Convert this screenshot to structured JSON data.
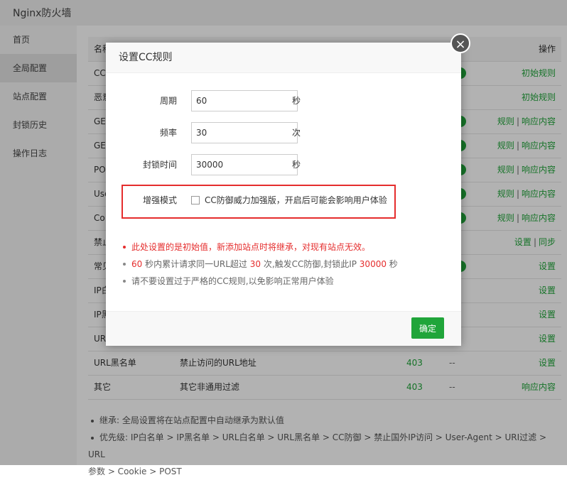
{
  "app": {
    "title": "Nginx防火墙"
  },
  "sidebar": {
    "items": [
      {
        "label": "首页"
      },
      {
        "label": "全局配置"
      },
      {
        "label": "站点配置"
      },
      {
        "label": "封锁历史"
      },
      {
        "label": "操作日志"
      }
    ],
    "active_index": 1
  },
  "table": {
    "header": {
      "name": "名称",
      "ops": "操作"
    },
    "rows": [
      {
        "name": "CC",
        "desc": "",
        "code": "",
        "dash": "",
        "ops": [
          "初始规则"
        ],
        "toggle": true
      },
      {
        "name": "恶意",
        "desc": "",
        "code": "",
        "dash": "",
        "ops": [
          "初始规则"
        ],
        "toggle": false
      },
      {
        "name": "GE",
        "desc": "",
        "code": "",
        "dash": "",
        "ops": [
          "规则",
          "响应内容"
        ],
        "toggle": true
      },
      {
        "name": "GE",
        "desc": "",
        "code": "",
        "dash": "",
        "ops": [
          "规则",
          "响应内容"
        ],
        "toggle": true
      },
      {
        "name": "PO",
        "desc": "",
        "code": "",
        "dash": "",
        "ops": [
          "规则",
          "响应内容"
        ],
        "toggle": true
      },
      {
        "name": "Use",
        "desc": "",
        "code": "",
        "dash": "",
        "ops": [
          "规则",
          "响应内容"
        ],
        "toggle": true
      },
      {
        "name": "Co",
        "desc": "",
        "code": "",
        "dash": "",
        "ops": [
          "规则",
          "响应内容"
        ],
        "toggle": true
      },
      {
        "name": "禁止",
        "desc": "",
        "code": "",
        "dash": "",
        "ops": [
          "设置",
          "同步"
        ],
        "toggle": false
      },
      {
        "name": "常见",
        "desc": "",
        "code": "",
        "dash": "",
        "ops": [
          "设置"
        ],
        "toggle": true
      },
      {
        "name": "IP白",
        "desc": "",
        "code": "",
        "dash": "",
        "ops": [
          "设置"
        ],
        "toggle": false
      },
      {
        "name": "IP黑",
        "desc": "",
        "code": "",
        "dash": "",
        "ops": [
          "设置"
        ],
        "toggle": false
      },
      {
        "name": "URL",
        "desc": "",
        "code": "",
        "dash": "",
        "ops": [
          "设置"
        ],
        "toggle": false
      },
      {
        "name": "URL黑名单",
        "desc": "禁止访问的URL地址",
        "code": "403",
        "dash": "--",
        "ops": [
          "设置"
        ],
        "toggle": false
      },
      {
        "name": "其它",
        "desc": "其它非通用过滤",
        "code": "403",
        "dash": "--",
        "ops": [
          "响应内容"
        ],
        "toggle": false
      }
    ]
  },
  "notes": [
    "继承: 全局设置将在站点配置中自动继承为默认值",
    "优先级: IP白名单 > IP黑名单 > URL白名单 > URL黑名单 > CC防御 > 禁止国外IP访问 > User-Agent > URI过滤 > URL",
    "参数 > Cookie > POST"
  ],
  "modal": {
    "title": "设置CC规则",
    "close_symbol": "×",
    "fields": [
      {
        "label": "周期",
        "value": "60",
        "unit": "秒"
      },
      {
        "label": "频率",
        "value": "30",
        "unit": "次"
      },
      {
        "label": "封锁时间",
        "value": "30000",
        "unit": "秒"
      }
    ],
    "enhance": {
      "label": "增强模式",
      "checkbox_text": "CC防御威力加强版，开启后可能会影响用户体验",
      "checked": false
    },
    "tips": {
      "line1": "此处设置的是初始值，新添加站点时将继承，对现有站点无效。",
      "line2": {
        "cycle": "60",
        "t1": " 秒内累计请求同一URL超过 ",
        "freq": "30",
        "t2": " 次,触发CC防御,封锁此IP ",
        "block": "30000",
        "t3": " 秒"
      },
      "line3": "请不要设置过于严格的CC规则,以免影响正常用户体验"
    },
    "ok_label": "确定"
  },
  "colors": {
    "accent": "#20a53a",
    "danger": "#e52d2d"
  }
}
